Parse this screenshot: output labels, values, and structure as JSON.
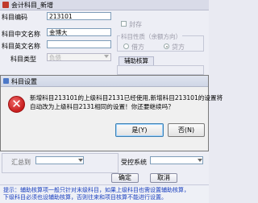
{
  "window": {
    "title": "会计科目_新增"
  },
  "form": {
    "code_label": "科目编码",
    "code_value": "213101",
    "cn_name_label": "科目中文名称",
    "cn_name_value": "金博大",
    "en_name_label": "科目英文名称",
    "en_name_value": "",
    "type_label": "科目类型",
    "type_value": "负债",
    "seal_label": "封存",
    "nature_group_title": "科目性质（余额方向）",
    "nature_debit": "借方",
    "nature_credit": "贷方",
    "assist_tab": "辅助核算",
    "summary_label": "汇总到",
    "summary_value": "",
    "system_label": "受控系统",
    "system_value": "",
    "confirm_button": "确定",
    "cancel_button": "取消"
  },
  "dialog": {
    "title": "科目设置",
    "message_lines": [
      "新增科目213101的上级科目2131已经使用,新增科目213101的设置将",
      "自动改为上级科目2131相同的设置！你还要继续吗？"
    ],
    "yes_button": "是(Y)",
    "no_button": "否(N)",
    "icon": "error-icon"
  },
  "tip": {
    "lines": [
      "提示：辅助核算项一般只针对末级科目，如果上级科目也需设置辅助核算，",
      "下级科目必须也设辅助核算，否则往来和项目核算不能进行设置。"
    ]
  },
  "colors": {
    "dialog_bg": "#f0f0f0",
    "error_red": "#c71c1c",
    "tip_text": "#1a3fbf",
    "window_bg": "#edeef5"
  }
}
